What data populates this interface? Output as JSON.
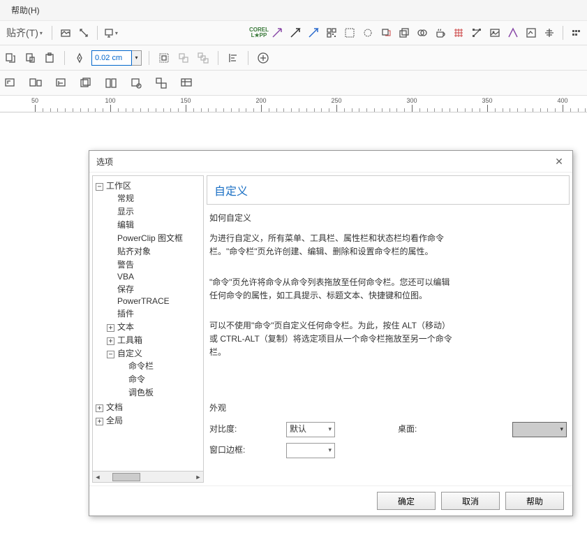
{
  "menubar": {
    "help": "帮助(H)"
  },
  "toolbar": {
    "snap_label": "贴齐(T)",
    "outline_width": "0.02 cm"
  },
  "ruler": {
    "marks": [
      "50",
      "100",
      "150",
      "200",
      "250",
      "300",
      "350",
      "400"
    ]
  },
  "dialog": {
    "title": "选项",
    "tree": {
      "workspace": "工作区",
      "general": "常规",
      "display": "显示",
      "edit": "编辑",
      "powerclip": "PowerClip 图文框",
      "snap": "贴齐对象",
      "warning": "警告",
      "vba": "VBA",
      "save": "保存",
      "powertrace": "PowerTRACE",
      "plugin": "插件",
      "text": "文本",
      "toolbox": "工具箱",
      "customize": "自定义",
      "cmdbar": "命令栏",
      "cmd": "命令",
      "palette": "调色板",
      "document": "文档",
      "global": "全局"
    },
    "content": {
      "title": "自定义",
      "subtitle": "如何自定义",
      "p1": "为进行自定义，所有菜单、工具栏、属性栏和状态栏均看作命令栏。\"命令栏\"页允许创建、编辑、删除和设置命令栏的属性。",
      "p2": "\"命令\"页允许将命令从命令列表拖放至任何命令栏。您还可以编辑任何命令的属性，如工具提示、标题文本、快捷键和位图。",
      "p3": "可以不使用\"命令\"页自定义任何命令栏。为此，按住 ALT（移动）或 CTRL-ALT（复制）将选定项目从一个命令栏拖放至另一个命令栏。",
      "appearance_label": "外观",
      "contrast_label": "对比度:",
      "contrast_value": "默认",
      "desktop_label": "桌面:",
      "border_label": "窗口边框:"
    },
    "buttons": {
      "ok": "确定",
      "cancel": "取消",
      "help": "帮助"
    }
  }
}
